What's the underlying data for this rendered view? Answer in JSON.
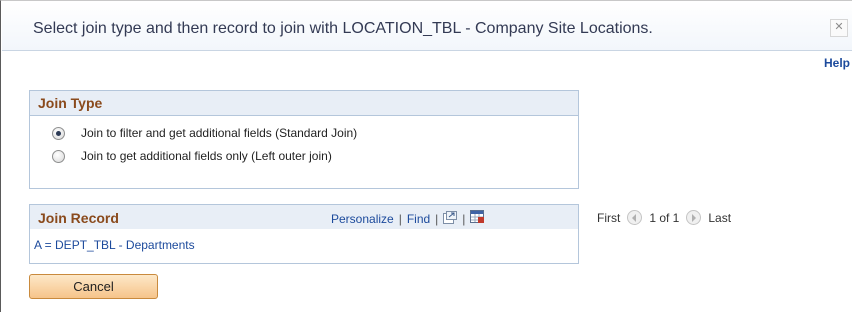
{
  "dialog": {
    "title": "Select join type and then record to join with LOCATION_TBL - Company Site Locations.",
    "close_icon": "close-icon",
    "help_label": "Help"
  },
  "join_type": {
    "title": "Join Type",
    "options": [
      {
        "label": "Join to filter and get additional fields (Standard Join)",
        "selected": true
      },
      {
        "label": "Join to get additional fields only (Left outer join)",
        "selected": false
      }
    ]
  },
  "join_record": {
    "title": "Join Record",
    "personalize_label": "Personalize",
    "find_label": "Find",
    "separator": "|",
    "view_all_icon": "new-window-icon",
    "download_icon": "spreadsheet-icon",
    "first_label": "First",
    "page_info": "1 of 1",
    "last_label": "Last",
    "rows": [
      {
        "label": "A = DEPT_TBL - Departments"
      }
    ]
  },
  "buttons": {
    "cancel_label": "Cancel"
  },
  "colors": {
    "title_text": "#333a54",
    "section_title": "#8a4a1c",
    "link": "#1c4a9c",
    "header_bg": "#e8eef6",
    "border": "#b4c6db",
    "button_bg": "#f6c48a"
  }
}
